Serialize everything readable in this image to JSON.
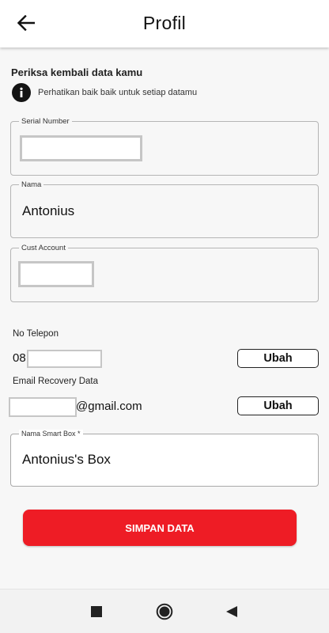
{
  "header": {
    "title": "Profil",
    "back_icon": "arrow-left-icon"
  },
  "section": {
    "title": "Periksa kembali data kamu",
    "info_icon": "info-icon",
    "info_text": "Perhatikan baik baik untuk setiap datamu"
  },
  "fields": {
    "serial_number": {
      "label": "Serial Number",
      "value": ""
    },
    "nama": {
      "label": "Nama",
      "value": "Antonius"
    },
    "cust_account": {
      "label": "Cust Account",
      "value": ""
    },
    "smart_box": {
      "label": "Nama Smart Box *",
      "value": "Antonius's Box"
    }
  },
  "phone": {
    "label": "No Telepon",
    "prefix": "08",
    "button": "Ubah"
  },
  "email": {
    "label": "Email Recovery Data",
    "suffix": "@gmail.com",
    "button": "Ubah"
  },
  "save_button": "SIMPAN DATA",
  "colors": {
    "primary": "#ee1c25",
    "background": "#f7f7f7",
    "appbar": "#ffffff"
  },
  "nav_icons": [
    "square-icon",
    "circle-icon",
    "triangle-back-icon"
  ]
}
